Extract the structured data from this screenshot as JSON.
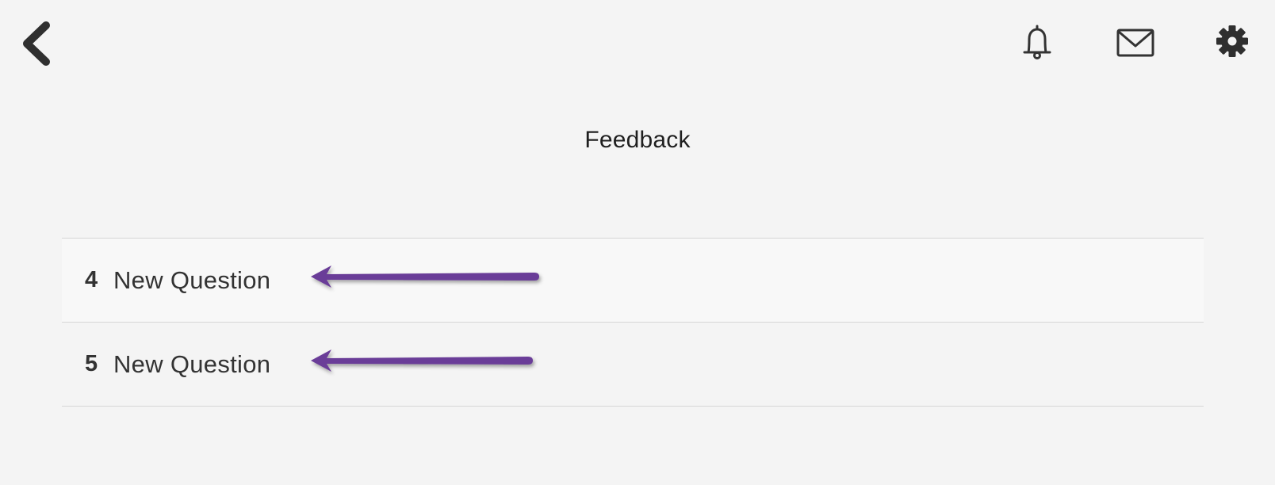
{
  "header": {
    "back_icon": "chevron-left-icon",
    "icons": [
      "bell-icon",
      "mail-icon",
      "gear-icon"
    ]
  },
  "page": {
    "title": "Feedback"
  },
  "questions": [
    {
      "number": "4",
      "label": "New Question"
    },
    {
      "number": "5",
      "label": "New Question"
    }
  ],
  "colors": {
    "background": "#f4f4f4",
    "annotation_arrow": "#6a3d98",
    "divider": "#d6d6d6"
  }
}
